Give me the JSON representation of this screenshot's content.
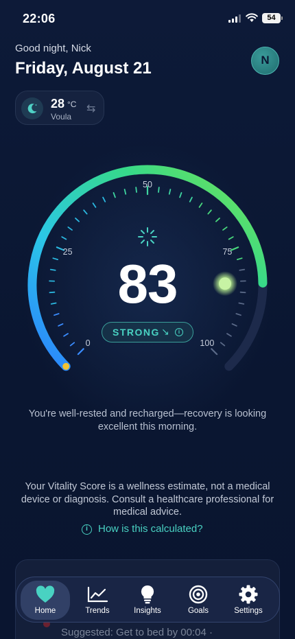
{
  "status_bar": {
    "time": "22:06",
    "battery": "54"
  },
  "header": {
    "greeting": "Good night, Nick",
    "date": "Friday, August 21",
    "avatar_initial": "N"
  },
  "weather": {
    "temperature": "28",
    "unit": "°C",
    "location": "Voula"
  },
  "gauge": {
    "score": 83,
    "min": 0,
    "max": 100,
    "tick_labels": [
      "0",
      "25",
      "50",
      "75",
      "100"
    ],
    "status_label": "STRONG",
    "gradient_colors": [
      "#2b7fff",
      "#2bc7e6",
      "#36d98a",
      "#7be34f"
    ],
    "marker_color": "#c7f3a4"
  },
  "message": "You're well-rested and recharged—recovery is looking excellent this morning.",
  "disclaimer": "Your Vitality Score is a wellness estimate, not a medical device or diagnosis. Consult a healthcare professional for medical advice.",
  "how_link": "How is this calculated?",
  "card": {
    "suggestion": "Suggested: Get to bed by 00:04 ·"
  },
  "tabs": [
    {
      "label": "Home",
      "icon": "heart-icon",
      "active": true
    },
    {
      "label": "Trends",
      "icon": "trend-chart-icon",
      "active": false
    },
    {
      "label": "Insights",
      "icon": "lightbulb-icon",
      "active": false
    },
    {
      "label": "Goals",
      "icon": "target-icon",
      "active": false
    },
    {
      "label": "Settings",
      "icon": "gear-icon",
      "active": false
    }
  ],
  "colors": {
    "background": "#0b1733",
    "accent": "#49d2c2"
  }
}
